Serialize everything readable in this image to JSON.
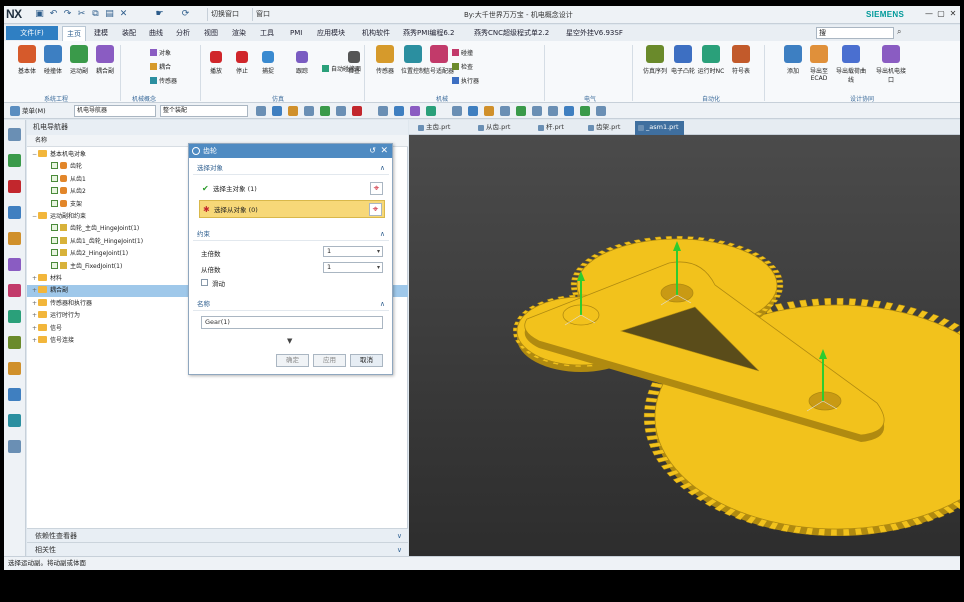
{
  "app": {
    "logo": "NX",
    "title": "By:大千世界万万宝 - 机电概念设计",
    "brand": "SIEMENS",
    "window_menu": "窗口",
    "switch_window": "切换窗口"
  },
  "menubar": {
    "file": "文件(F)",
    "tabs": [
      "主页",
      "建模",
      "装配",
      "曲线",
      "分析",
      "视图",
      "渲染",
      "工具",
      "PMI",
      "应用模块",
      "机构软件",
      "燕秀PMI编程6.2",
      "燕秀CNC超级程式单2.2",
      "星空外挂V6.93SF"
    ],
    "search_placeholder": "搜"
  },
  "ribbon": {
    "buttons": [
      "基本体",
      "碰撞体",
      "运动副",
      "耦合副",
      "传感器",
      "位置控制",
      "信号适配器",
      "仿真序列",
      "电子凸轮",
      "运行时NC",
      "符号表",
      "添加",
      "导出至ECAD",
      "导出载荷曲线",
      "导出机电接口"
    ],
    "small_items": [
      "对象",
      "耦合",
      "传感器",
      "碰撞",
      "检查",
      "执行器",
      "自动碰撞面"
    ],
    "sim_buttons": [
      "播放",
      "停止",
      "捕捉",
      "跟踪",
      "检查"
    ],
    "groups": [
      "系统工程",
      "机械概念",
      "仿真",
      "机械",
      "电气",
      "自动化",
      "设计协同"
    ]
  },
  "toolbar": {
    "menu": "菜单(M)",
    "filter": "机电导航器",
    "assembly": "整个装配"
  },
  "navigator": {
    "title": "机电导航器",
    "col_name": "名称",
    "nodes": [
      {
        "label": "基本机电对象",
        "level": 0,
        "kind": "folder"
      },
      {
        "label": "齿轮",
        "level": 2,
        "kind": "part"
      },
      {
        "label": "从齿1",
        "level": 2,
        "kind": "part"
      },
      {
        "label": "从齿2",
        "level": 2,
        "kind": "part"
      },
      {
        "label": "支架",
        "level": 2,
        "kind": "part"
      },
      {
        "label": "运动副和约束",
        "level": 0,
        "kind": "folder"
      },
      {
        "label": "齿轮_主齿_HingeJoint(1)",
        "level": 2,
        "kind": "joint"
      },
      {
        "label": "从齿1_齿轮_HingeJoint(1)",
        "level": 2,
        "kind": "joint"
      },
      {
        "label": "从齿2_HingeJoint(1)",
        "level": 2,
        "kind": "joint"
      },
      {
        "label": "主齿_FixedJoint(1)",
        "level": 2,
        "kind": "joint"
      },
      {
        "label": "材料",
        "level": 0,
        "kind": "folder"
      },
      {
        "label": "耦合副",
        "level": 0,
        "kind": "folder",
        "selected": true
      },
      {
        "label": "传感器和执行器",
        "level": 0,
        "kind": "folder"
      },
      {
        "label": "运行时行为",
        "level": 0,
        "kind": "folder"
      },
      {
        "label": "信号",
        "level": 0,
        "kind": "folder"
      },
      {
        "label": "信号连接",
        "level": 0,
        "kind": "folder"
      }
    ],
    "bottom_sections": [
      "依赖性查看器",
      "相关性"
    ]
  },
  "dialog": {
    "title": "齿轮",
    "section_select": "选择对象",
    "master": "选择主对象 (1)",
    "slave": "选择从对象 (0)",
    "section_constraint": "约束",
    "master_teeth_label": "主倍数",
    "master_teeth_value": "1",
    "slave_teeth_label": "从倍数",
    "slave_teeth_value": "1",
    "slip_label": "滑动",
    "section_name": "名称",
    "name_value": "Gear(1)",
    "ok": "确定",
    "apply": "应用",
    "cancel": "取消"
  },
  "doctabs": [
    "主齿.prt",
    "从齿.prt",
    "杆.prt",
    "齿架.prt",
    "_asm1.prt"
  ],
  "viewport": {
    "model_color": "#f2c21c",
    "edge_color": "#b08a10",
    "axis_color": "#2ecc2e"
  },
  "status": "选择运动副。将动副或体面"
}
